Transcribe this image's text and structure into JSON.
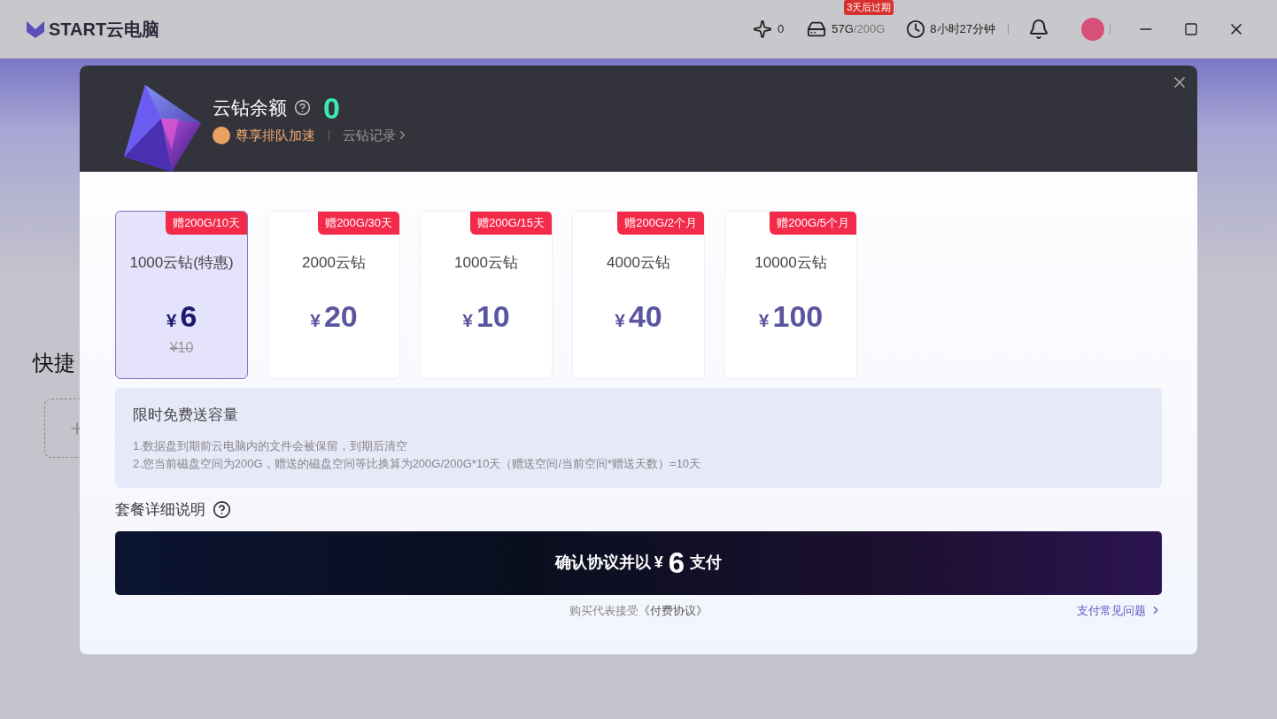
{
  "titlebar": {
    "logo": "START云电脑",
    "diamonds": "0",
    "storage_used": "57G",
    "storage_total": "/200G",
    "expiry_badge": "3天后过期",
    "time_left": "8小时27分钟"
  },
  "background": {
    "section_title": "快捷"
  },
  "modal": {
    "balance_label": "云钻余额",
    "balance": "0",
    "priority": "尊享排队加速",
    "history_link": "云钻记录",
    "packages": [
      {
        "bonus": "赠200G/10天",
        "name": "1000云钻(特惠)",
        "currency": "¥",
        "price": "6",
        "original_price": "¥10",
        "selected": true
      },
      {
        "bonus": "赠200G/30天",
        "name": "2000云钻",
        "currency": "¥",
        "price": "20",
        "selected": false
      },
      {
        "bonus": "赠200G/15天",
        "name": "1000云钻",
        "currency": "¥",
        "price": "10",
        "selected": false
      },
      {
        "bonus": "赠200G/2个月",
        "name": "4000云钻",
        "currency": "¥",
        "price": "40",
        "selected": false
      },
      {
        "bonus": "赠200G/5个月",
        "name": "10000云钻",
        "currency": "¥",
        "price": "100",
        "selected": false
      }
    ],
    "promo": {
      "title": "限时免费送容量",
      "notes": [
        "1.数据盘到期前云电脑内的文件会被保留，到期后清空",
        "2.您当前磁盘空间为200G，赠送的磁盘空间等比换算为200G/200G*10天（赠送空间/当前空间*赠送天数）=10天"
      ]
    },
    "details_label": "套餐详细说明",
    "pay_button": {
      "prefix": "确认协议并以",
      "currency": "¥",
      "amount": "6",
      "suffix": "支付"
    },
    "agreement": {
      "text": "购买代表接受",
      "link": "《付费协议》"
    },
    "faq_link": "支付常见问题"
  }
}
